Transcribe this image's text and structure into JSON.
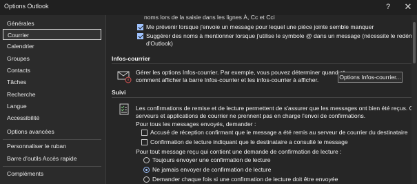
{
  "window": {
    "title": "Options Outlook",
    "help_glyph": "?",
    "close_glyph": "✕"
  },
  "sidebar": {
    "items": [
      {
        "label": "Générales"
      },
      {
        "label": "Courrier"
      },
      {
        "label": "Calendrier"
      },
      {
        "label": "Groupes"
      },
      {
        "label": "Contacts"
      },
      {
        "label": "Tâches"
      },
      {
        "label": "Recherche"
      },
      {
        "label": "Langue"
      },
      {
        "label": "Accessibilité"
      },
      {
        "label": "Options avancées"
      },
      {
        "label": "Personnaliser le ruban"
      },
      {
        "label": "Barre d'outils Accès rapide"
      },
      {
        "label": "Compléments"
      }
    ],
    "selected": "Courrier"
  },
  "content": {
    "top_text_cut": "noms lors de la saisie dans les lignes À, Cc et Cci",
    "opt_attachment": {
      "label": "Me prévenir lorsque j'envoie un message pour lequel une pièce jointe semble manquer",
      "checked": true
    },
    "opt_mentions": {
      "label_line1": "Suggérer des noms à mentionner lorsque j'utilise le symbole @ dans un message (nécessite le redémarrage",
      "label_line2": "d'Outlook)",
      "checked": true
    },
    "infos": {
      "heading": "Infos-courrier",
      "desc_line1": "Gérer les options Infos-courrier. Par exemple, vous pouvez déterminer quand et",
      "desc_line2": "comment afficher la barre Infos-courrier et les infos-courrier à afficher.",
      "button_label": "Options Infos-courrier..."
    },
    "suivi": {
      "heading": "Suivi",
      "desc_line1": "Les confirmations de remise et de lecture permettent de s'assurer que les messages ont bien été reçus. Certains",
      "desc_line2": "serveurs et applications de courrier ne prennent pas en charge l'envoi de confirmations.",
      "sent_label": "Pour tous les messages envoyés, demander :",
      "opt_delivery": {
        "label": "Accusé de réception confirmant que le message a été remis au serveur de courrier du destinataire",
        "checked": false
      },
      "opt_read": {
        "label": "Confirmation de lecture indiquant que le destinataire a consulté le message",
        "checked": false
      },
      "received_label": "Pour tout message reçu qui contient une demande de confirmation de lecture :",
      "radio_options": [
        {
          "label": "Toujours envoyer une confirmation de lecture",
          "selected": false
        },
        {
          "label": "Ne jamais envoyer de confirmation de lecture",
          "selected": true
        },
        {
          "label": "Demander chaque fois si une confirmation de lecture doit être envoyée",
          "selected": false
        }
      ]
    }
  }
}
